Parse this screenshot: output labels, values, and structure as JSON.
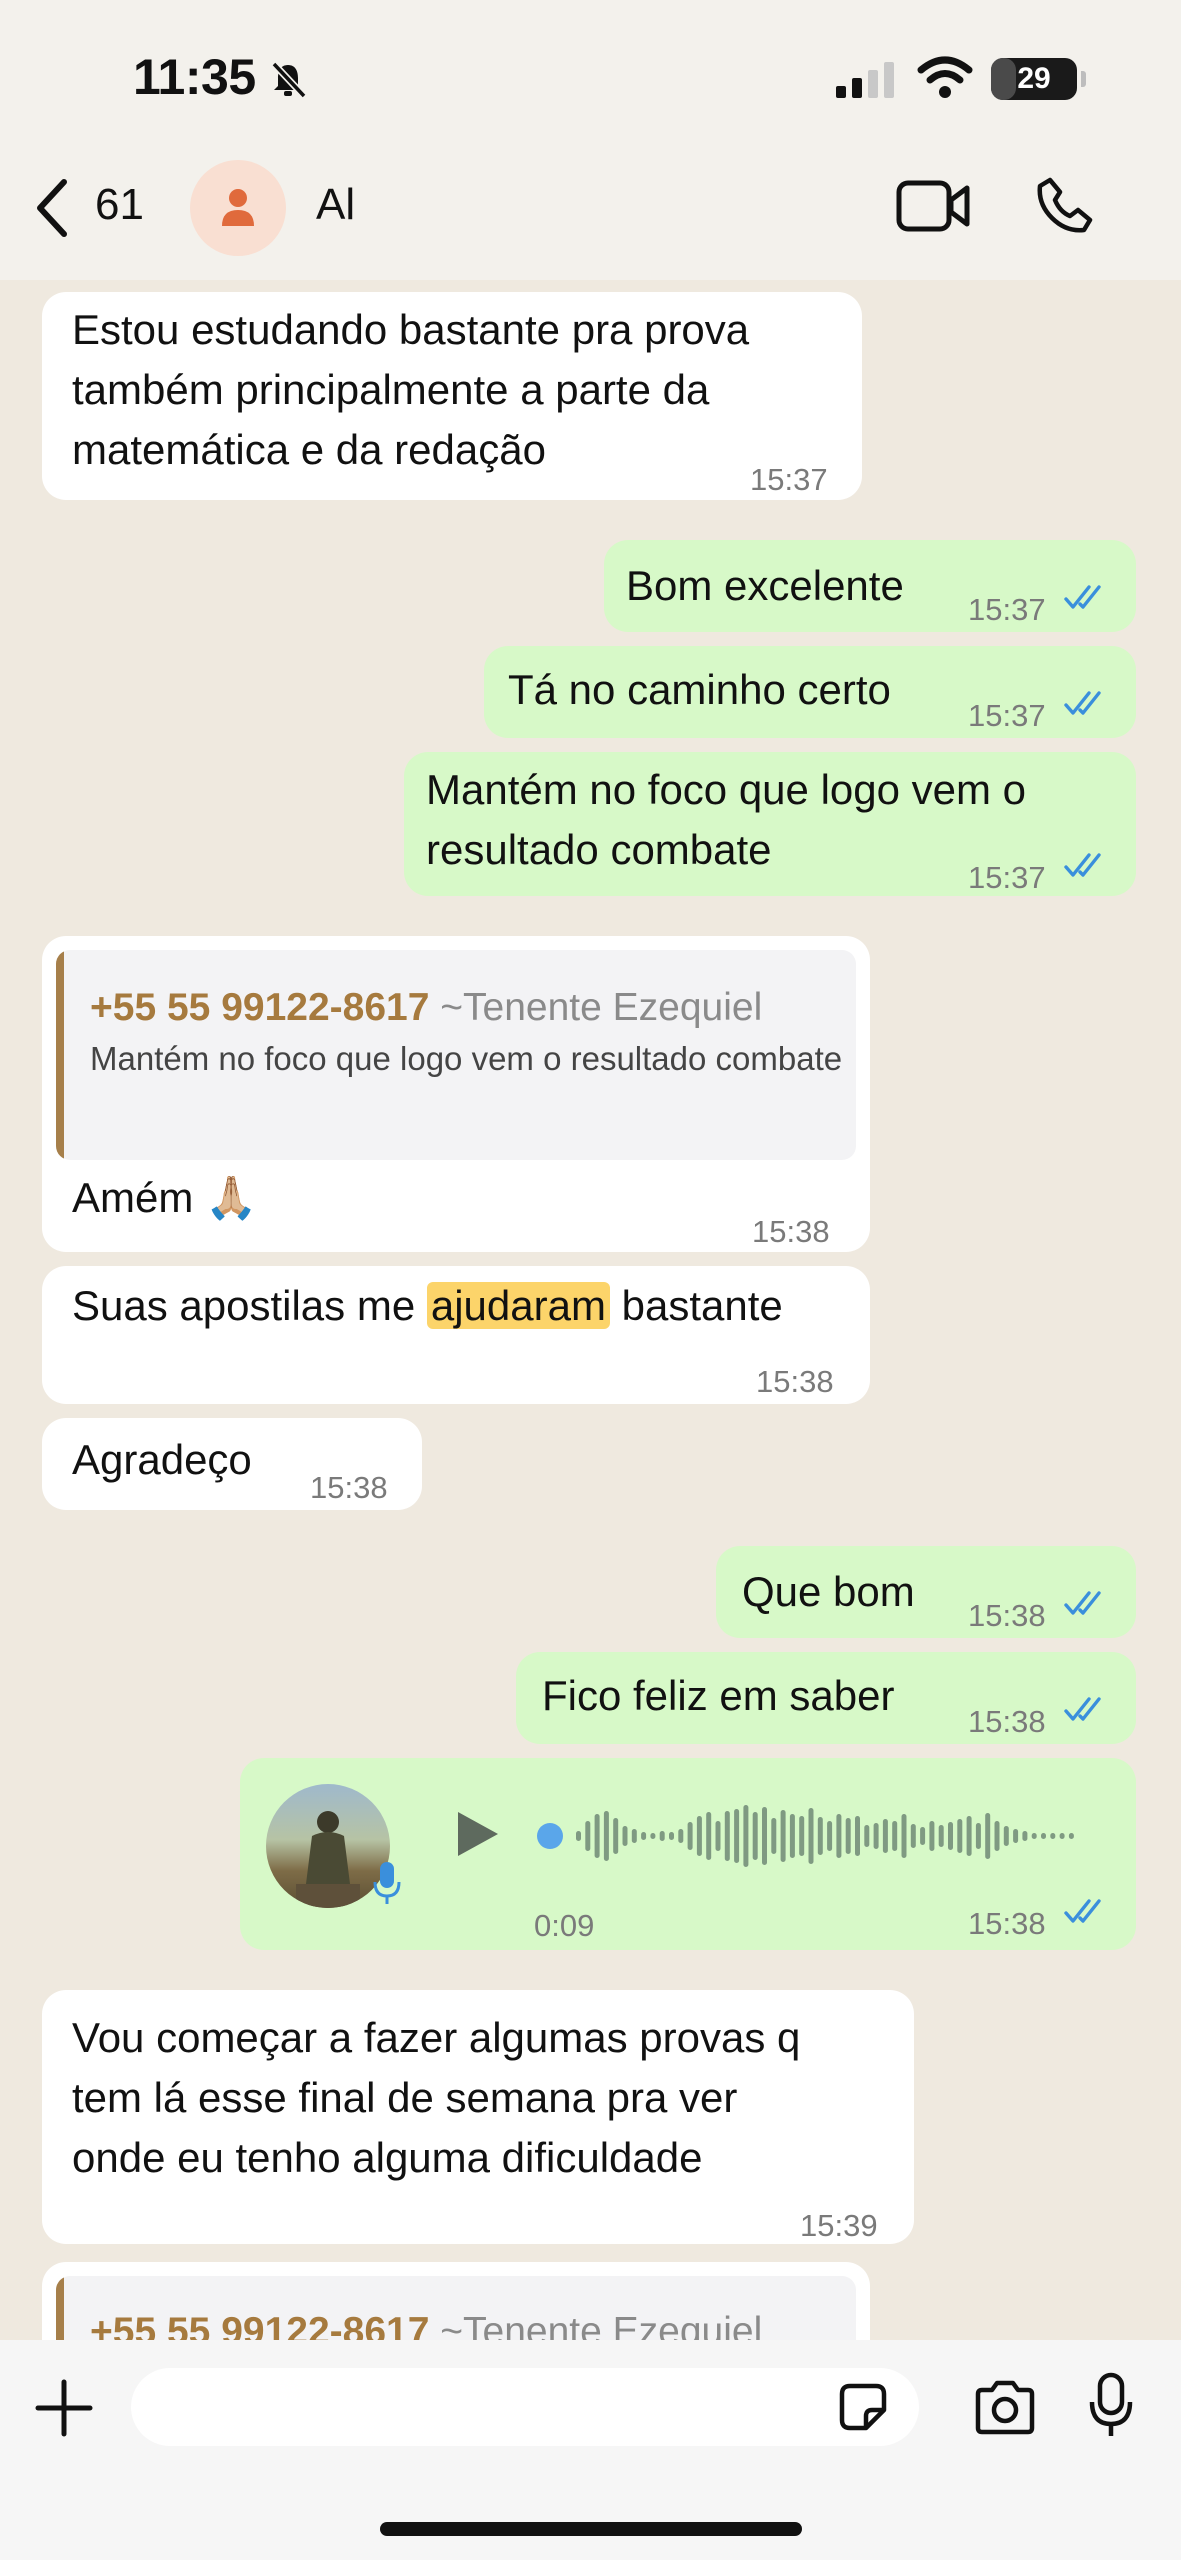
{
  "status_bar": {
    "time": "11:35",
    "battery": "29",
    "battery_level": 0.29
  },
  "header": {
    "back_count": "61",
    "contact_name": "Al"
  },
  "messages": [
    {
      "dir": "in",
      "text": "Estou estudando bastante pra prova\ntambém principalmente a parte da\nmatemática e da redação",
      "time": "15:37"
    },
    {
      "dir": "out",
      "text": "Bom excelente",
      "time": "15:37"
    },
    {
      "dir": "out",
      "text": "Tá no caminho certo",
      "time": "15:37"
    },
    {
      "dir": "out",
      "text": "Mantém no foco que logo vem o\nresultado combate",
      "time": "15:37"
    },
    {
      "dir": "in",
      "quote": {
        "sender": "+55 55 99122-8617",
        "name": "~Tenente Ezequiel",
        "text": "Mantém no foco que logo vem o resultado combate"
      },
      "text": "Amém 🙏🏼",
      "time": "15:38"
    },
    {
      "dir": "in",
      "text_before": "Suas apostilas me ",
      "highlight": "ajudaram",
      "text_after": " bastante",
      "time": "15:38"
    },
    {
      "dir": "in",
      "text": "Agradeço",
      "time": "15:38"
    },
    {
      "dir": "out",
      "text": "Que bom",
      "time": "15:38"
    },
    {
      "dir": "out",
      "text": "Fico feliz em saber",
      "time": "15:38"
    },
    {
      "dir": "out",
      "type": "voice",
      "duration": "0:09",
      "time": "15:38"
    },
    {
      "dir": "in",
      "text": "Vou começar a fazer algumas provas q\ntem lá esse final de semana pra ver\nonde eu tenho alguma dificuldade",
      "time": "15:39"
    },
    {
      "dir": "in",
      "quote": {
        "sender": "+55 55 99122-8617",
        "name": "~Tenente Ezequiel"
      }
    }
  ],
  "icons": [
    "back-chevron-icon",
    "person-icon",
    "video-call-icon",
    "phone-icon",
    "mute-bell-icon",
    "signal-icon",
    "wifi-icon",
    "plus-icon",
    "sticker-icon",
    "camera-icon",
    "mic-icon",
    "play-icon",
    "double-check-icon"
  ],
  "colors": {
    "outgoing": "#d7f9c8",
    "incoming": "#ffffff",
    "read_ticks": "#3a8fdc",
    "quote_accent": "#a67f4a",
    "highlight": "#fcd46a"
  }
}
